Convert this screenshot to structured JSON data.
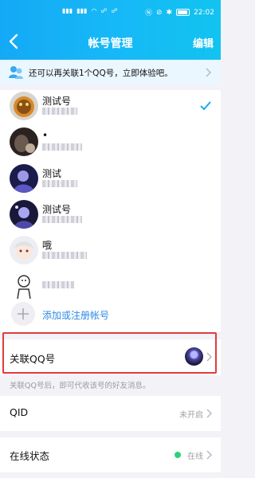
{
  "status_bar": {
    "left_text": "4G 4G 4G",
    "right_text": "N ⊘ ✱ 22:02",
    "time": "22:02"
  },
  "nav": {
    "title": "帐号管理",
    "edit_label": "编辑"
  },
  "notice": {
    "text": "还可以再关联1个QQ号，立即体验吧。"
  },
  "accounts": [
    {
      "name": "测试号",
      "selected": true
    },
    {
      "name": "•",
      "selected": false
    },
    {
      "name": "测试",
      "selected": false
    },
    {
      "name": "测试号",
      "selected": false
    },
    {
      "name": "哦",
      "selected": false
    },
    {
      "name": "",
      "selected": false
    }
  ],
  "add_account": {
    "label": "添加或注册帐号"
  },
  "linked_qq": {
    "label": "关联QQ号",
    "description": "关联QQ号后，即可代收该号的好友消息。"
  },
  "qid": {
    "label": "QID",
    "value": "未开启"
  },
  "online_status": {
    "label": "在线状态",
    "value": "在线"
  },
  "colors": {
    "header": "#16b8f7",
    "accent_blue": "#2e8ae6",
    "highlight_red": "#e23b3b",
    "online_green": "#2ed17b"
  }
}
